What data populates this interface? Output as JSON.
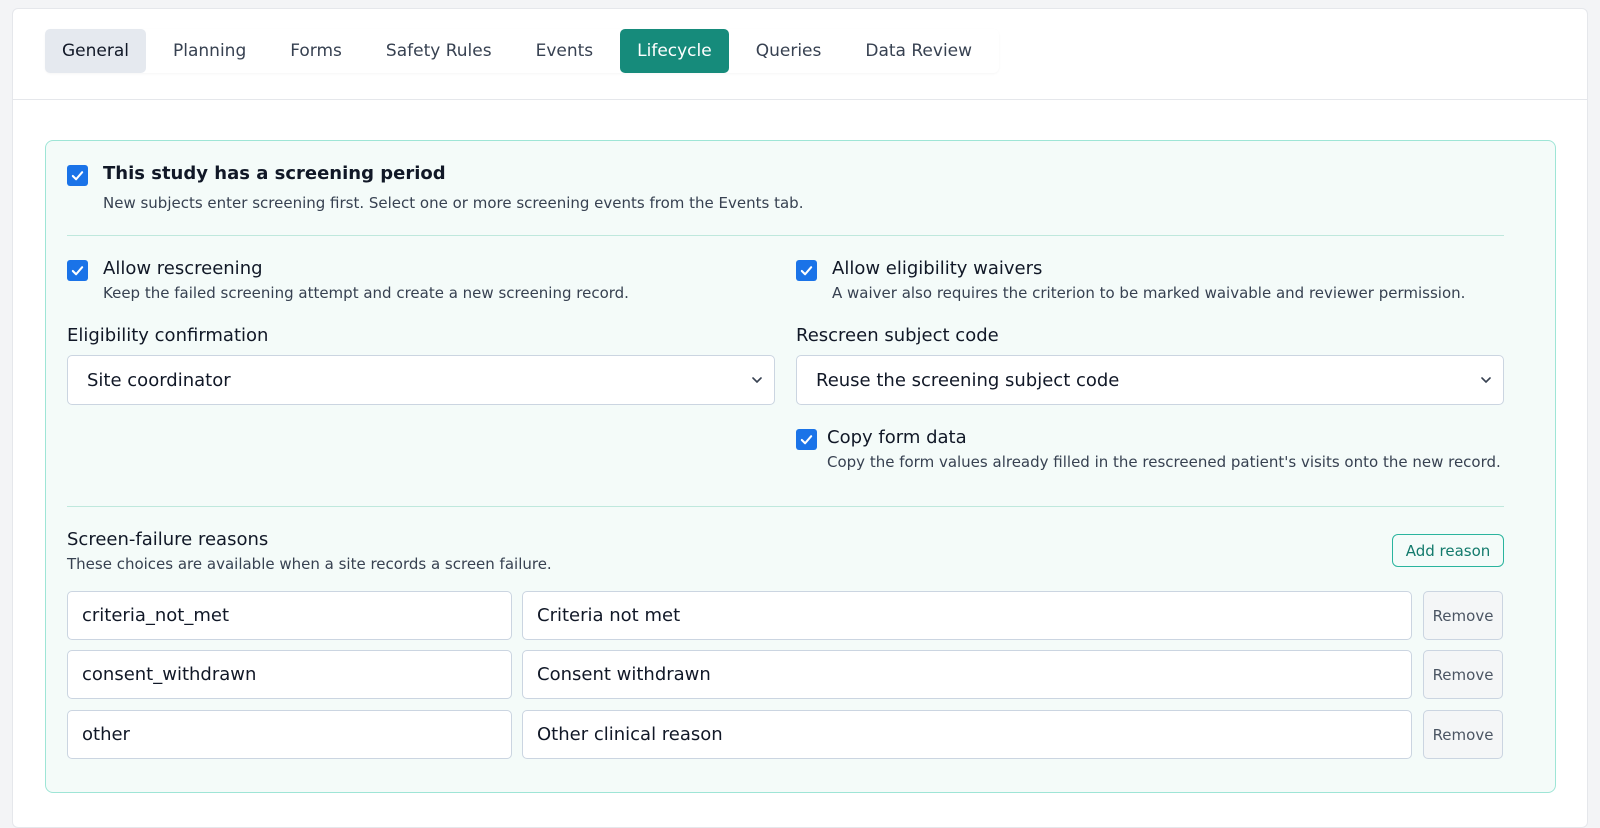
{
  "tabs": [
    {
      "label": "General",
      "state": "hover"
    },
    {
      "label": "Planning",
      "state": "default"
    },
    {
      "label": "Forms",
      "state": "default"
    },
    {
      "label": "Safety Rules",
      "state": "default"
    },
    {
      "label": "Events",
      "state": "default"
    },
    {
      "label": "Lifecycle",
      "state": "active"
    },
    {
      "label": "Queries",
      "state": "default"
    },
    {
      "label": "Data Review",
      "state": "default"
    }
  ],
  "screening": {
    "checked": true,
    "label": "This study has a screening period",
    "description": "New subjects enter screening first. Select one or more screening events from the Events tab."
  },
  "rescreening": {
    "checked": true,
    "label": "Allow rescreening",
    "description": "Keep the failed screening attempt and create a new screening record."
  },
  "waivers": {
    "checked": true,
    "label": "Allow eligibility waivers",
    "description": "A waiver also requires the criterion to be marked waivable and reviewer permission."
  },
  "eligibility_confirmation": {
    "label": "Eligibility confirmation",
    "value": "Site coordinator"
  },
  "rescreen_subject_code": {
    "label": "Rescreen subject code",
    "value": "Reuse the screening subject code"
  },
  "copy_form_data": {
    "checked": true,
    "label": "Copy form data",
    "description": "Copy the form values already filled in the rescreened patient's visits onto the new record."
  },
  "screen_failure": {
    "title": "Screen-failure reasons",
    "description": "These choices are available when a site records a screen failure.",
    "add_label": "Add reason",
    "remove_label": "Remove",
    "reasons": [
      {
        "code": "criteria_not_met",
        "label": "Criteria not met"
      },
      {
        "code": "consent_withdrawn",
        "label": "Consent withdrawn"
      },
      {
        "code": "other",
        "label": "Other clinical reason"
      }
    ]
  },
  "colors": {
    "accent": "#168b7b",
    "checkbox": "#1a73e8",
    "panel_bg": "#f4fbf9",
    "panel_border": "#9ee5d6"
  }
}
